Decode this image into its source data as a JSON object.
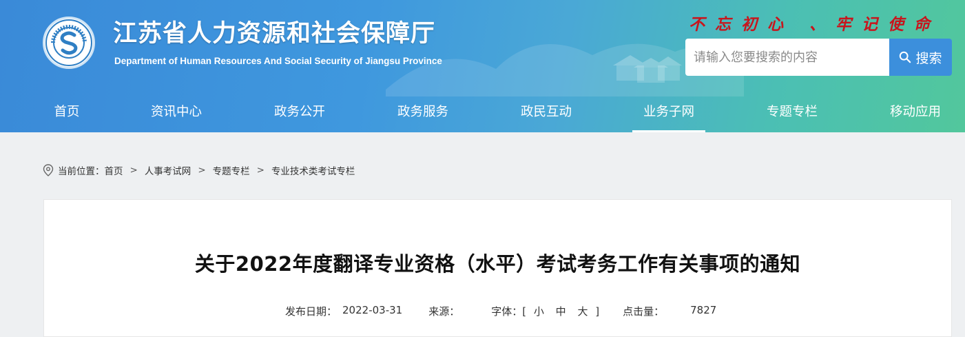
{
  "header": {
    "title": "江苏省人力资源和社会保障厅",
    "subtitle": "Department of Human Resources And Social Security of Jiangsu Province",
    "slogan": "不忘初心 、牢记使命",
    "logo_text": "江苏省人力资源和社会保障厅"
  },
  "search": {
    "placeholder": "请输入您要搜索的内容",
    "button_label": "搜索"
  },
  "nav": {
    "items": [
      {
        "label": "首页"
      },
      {
        "label": "资讯中心"
      },
      {
        "label": "政务公开"
      },
      {
        "label": "政务服务"
      },
      {
        "label": "政民互动"
      },
      {
        "label": "业务子网",
        "active": true
      },
      {
        "label": "专题专栏"
      },
      {
        "label": "移动应用"
      }
    ]
  },
  "breadcrumb": {
    "prefix": "当前位置：",
    "items": [
      "首页",
      "人事考试网",
      "专题专栏",
      "专业技术类考试专栏"
    ],
    "separator": ">"
  },
  "article": {
    "title": "关于2022年度翻译专业资格（水平）考试考务工作有关事项的通知",
    "publish_label": "发布日期：",
    "publish_date": "2022-03-31",
    "source_label": "来源：",
    "source_value": "",
    "font_label": "字体：[",
    "font_small": "小",
    "font_medium": "中",
    "font_large": "大",
    "font_close": "]",
    "views_label": "点击量：",
    "views_value": "7827"
  },
  "colors": {
    "header_gradient_start": "#3a8ad8",
    "header_gradient_end": "#52c79c",
    "slogan": "#c8151d",
    "search_button": "#3c8fdc"
  }
}
